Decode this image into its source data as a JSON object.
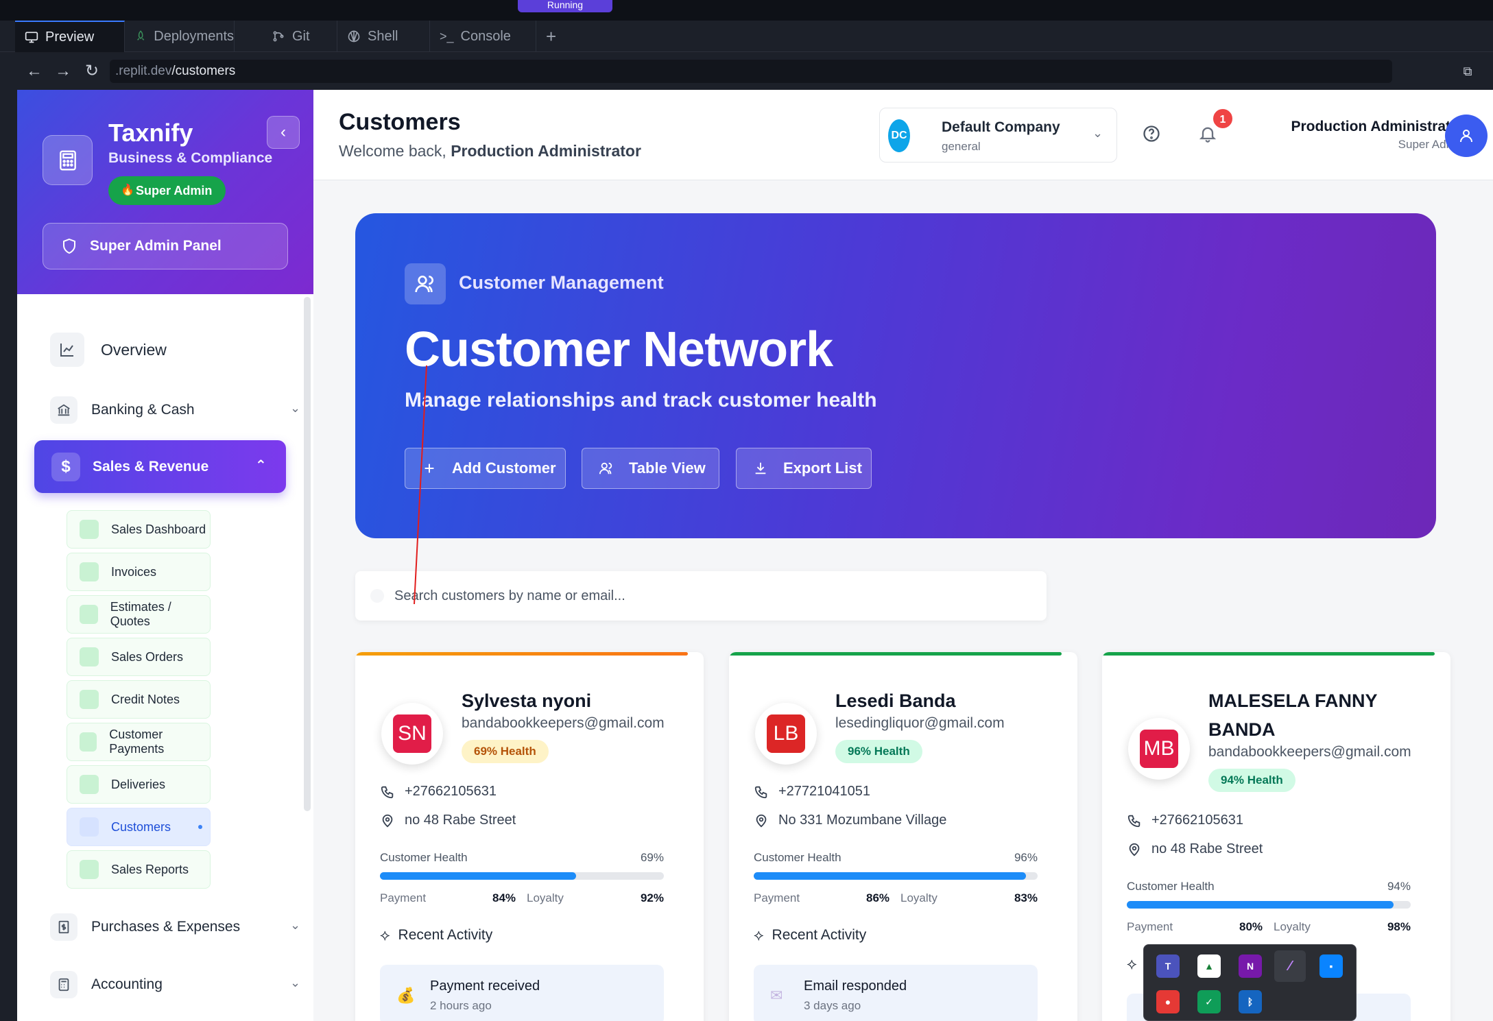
{
  "ide": {
    "run_label": "Running",
    "tabs": [
      {
        "label": "Preview",
        "icon": "monitor-icon"
      },
      {
        "label": "Deployments",
        "icon": "rocket-icon"
      },
      {
        "label": "Git",
        "icon": "git-icon"
      },
      {
        "label": "Shell",
        "icon": "shell-icon"
      },
      {
        "label": "Console",
        "icon": "terminal-icon"
      }
    ],
    "add_tab": "+",
    "url_host": ".replit.dev",
    "url_path": "/customers"
  },
  "sidebar": {
    "brand": "Taxnify",
    "brand_sub": "Business & Compliance",
    "role_badge": "Super Admin",
    "panel_button": "Super Admin Panel",
    "items": [
      {
        "label": "Overview",
        "icon": "chart-line-icon"
      },
      {
        "label": "Banking & Cash",
        "icon": "bank-icon"
      },
      {
        "label": "Sales & Revenue",
        "icon": "dollar-icon"
      },
      {
        "label": "Purchases & Expenses",
        "icon": "receipt-icon"
      },
      {
        "label": "Accounting",
        "icon": "calculator-icon"
      }
    ],
    "sub_items": [
      {
        "label": "Sales Dashboard"
      },
      {
        "label": "Invoices"
      },
      {
        "label": "Estimates / Quotes"
      },
      {
        "label": "Sales Orders"
      },
      {
        "label": "Credit Notes"
      },
      {
        "label": "Customer Payments"
      },
      {
        "label": "Deliveries"
      },
      {
        "label": "Customers"
      },
      {
        "label": "Sales Reports"
      }
    ]
  },
  "header": {
    "title": "Customers",
    "welcome_prefix": "Welcome back, ",
    "welcome_name": "Production Administrator",
    "company_initials": "DC",
    "company_name": "Default Company",
    "company_sub": "general",
    "notification_count": "1",
    "user_name": "Production Administrator",
    "user_role": "Super Admin"
  },
  "hero": {
    "category": "Customer Management",
    "title": "Customer Network",
    "subtitle": "Manage relationships and track customer health",
    "buttons": [
      {
        "label": "Add Customer",
        "icon": "plus-icon"
      },
      {
        "label": "Table View",
        "icon": "users-icon"
      },
      {
        "label": "Export List",
        "icon": "download-icon"
      }
    ]
  },
  "search": {
    "placeholder": "Search customers by name or email..."
  },
  "labels": {
    "customer_health": "Customer Health",
    "payment": "Payment",
    "loyalty": "Loyalty",
    "recent_activity": "Recent Activity"
  },
  "customers": [
    {
      "initials": "SN",
      "name": "Sylvesta nyoni",
      "email": "bandabookkeepers@gmail.com",
      "health_badge": "69% Health",
      "health": 69,
      "health_pct": "69%",
      "phone": "+27662105631",
      "address": "no 48 Rabe Street",
      "payment": "84%",
      "loyalty": "92%",
      "activity_title": "Payment received",
      "activity_time": "2 hours ago",
      "activity_icon": "money-bag-icon",
      "accent": "#f59e0b",
      "badge_bg": "#fef3c7",
      "badge_fg": "#b45309"
    },
    {
      "initials": "LB",
      "name": "Lesedi Banda",
      "email": "lesedingliquor@gmail.com",
      "health_badge": "96% Health",
      "health": 96,
      "health_pct": "96%",
      "phone": "+27721041051",
      "address": "No 331 Mozumbane Village",
      "payment": "86%",
      "loyalty": "83%",
      "activity_title": "Email responded",
      "activity_time": "3 days ago",
      "activity_icon": "envelope-icon",
      "accent": "#16a34a",
      "badge_bg": "#d1fae5",
      "badge_fg": "#047857"
    },
    {
      "initials": "MB",
      "name": "MALESELA FANNY BANDA",
      "email": "bandabookkeepers@gmail.com",
      "health_badge": "94% Health",
      "health": 94,
      "health_pct": "94%",
      "phone": "+27662105631",
      "address": "no 48 Rabe Street",
      "payment": "80%",
      "loyalty": "98%",
      "activity_title": "",
      "activity_time": "",
      "activity_icon": "",
      "accent": "#16a34a",
      "badge_bg": "#d1fae5",
      "badge_fg": "#047857"
    }
  ],
  "tray": {
    "apps": [
      "teams-icon",
      "drive-icon",
      "onenote-icon",
      "feather-icon",
      "store-icon",
      "recorder-icon",
      "defender-icon",
      "bluetooth-icon"
    ]
  }
}
